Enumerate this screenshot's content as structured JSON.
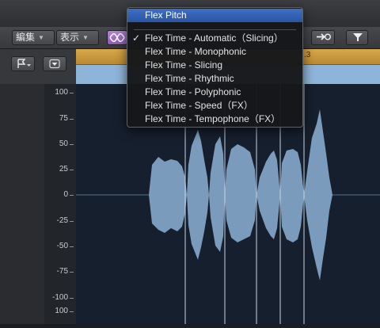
{
  "toolbar": {
    "edit_label": "編集",
    "view_label": "表示"
  },
  "ruler": {
    "bar_label": ".3"
  },
  "scale": {
    "ticks": [
      "100",
      "75",
      "50",
      "25",
      "0",
      "-25",
      "-50",
      "-75",
      "-100",
      "100"
    ]
  },
  "menu": {
    "header": "Flex Pitch",
    "items": [
      {
        "label": "Flex Time - Automatic（Slicing）",
        "checked": true
      },
      {
        "label": "Flex Time - Monophonic",
        "checked": false
      },
      {
        "label": "Flex Time - Slicing",
        "checked": false
      },
      {
        "label": "Flex Time - Rhythmic",
        "checked": false
      },
      {
        "label": "Flex Time - Polyphonic",
        "checked": false
      },
      {
        "label": "Flex Time - Speed（FX）",
        "checked": false
      },
      {
        "label": "Flex Time - Tempophone（FX）",
        "checked": false
      }
    ]
  },
  "colors": {
    "waveform": "#7b9bbd",
    "ruler": "#d8a74a",
    "highlight": "#2f5fb4",
    "flex_button": "#a070cc"
  }
}
